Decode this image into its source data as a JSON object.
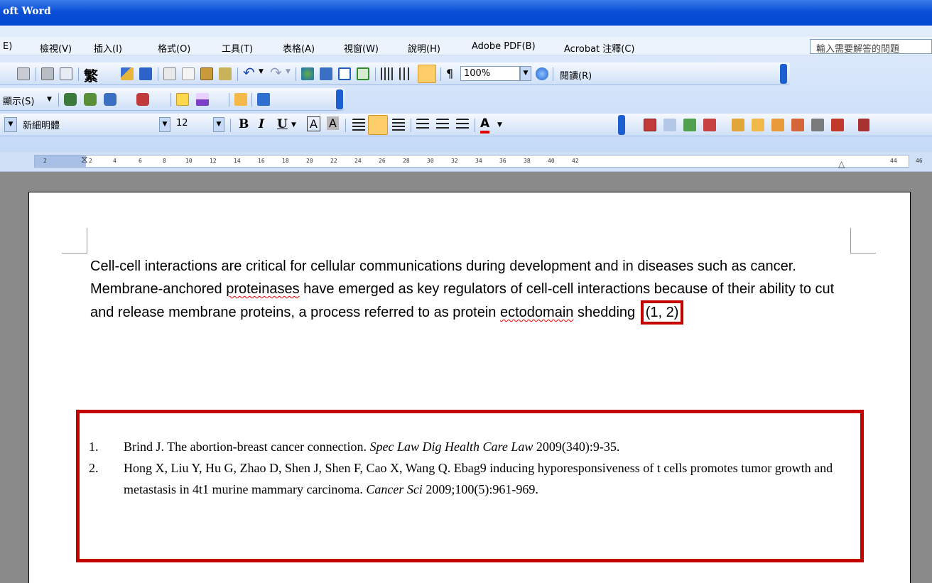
{
  "window": {
    "title": "oft Word"
  },
  "menu": {
    "items": [
      "E)",
      "檢視(V)",
      "插入(I)",
      "格式(O)",
      "工具(T)",
      "表格(A)",
      "視窗(W)",
      "說明(H)",
      "Adobe PDF(B)",
      "Acrobat 注釋(C)"
    ],
    "help_placeholder": "輸入需要解答的問題"
  },
  "toolbar": {
    "zoom": "100%",
    "read_label": "閱讀(R)",
    "traditional_glyph": "繁",
    "show_label": "顯示(S)",
    "font_name": "新細明體",
    "font_size": "12"
  },
  "ruler": {
    "ticks": [
      "2",
      "2",
      "4",
      "6",
      "8",
      "10",
      "12",
      "14",
      "16",
      "18",
      "20",
      "22",
      "24",
      "26",
      "28",
      "30",
      "32",
      "34",
      "36",
      "38",
      "40",
      "42",
      "44",
      "46"
    ]
  },
  "document": {
    "paragraph_before": "Cell-cell interactions are critical for cellular communications during development and in diseases such as cancer. Membrane-anchored ",
    "word_proteinases": "proteinases",
    "paragraph_mid": " have emerged as key regulators of cell-cell interactions because of their ability to cut and release membrane proteins, a process referred to as protein ",
    "word_ectodomain": "ectodomain",
    "paragraph_after": " shedding ",
    "citation": "(1, 2)",
    "references": [
      {
        "num": "1.",
        "pre": "Brind J. The abortion-breast cancer connection. ",
        "journal": "Spec Law Dig Health Care Law",
        "post": " 2009(340):9-35."
      },
      {
        "num": "2.",
        "pre": "Hong X, Liu Y, Hu G, Zhao D, Shen J, Shen F, Cao X, Wang Q. Ebag9 inducing hyporesponsiveness of t cells promotes tumor growth and metastasis in 4t1 murine mammary carcinoma. ",
        "journal": "Cancer Sci",
        "post": " 2009;100(5):961-969."
      }
    ]
  },
  "colors": {
    "highlight": "#c40000",
    "title_bar": "#0a4fd6",
    "spell_squiggle": "#e00000"
  }
}
